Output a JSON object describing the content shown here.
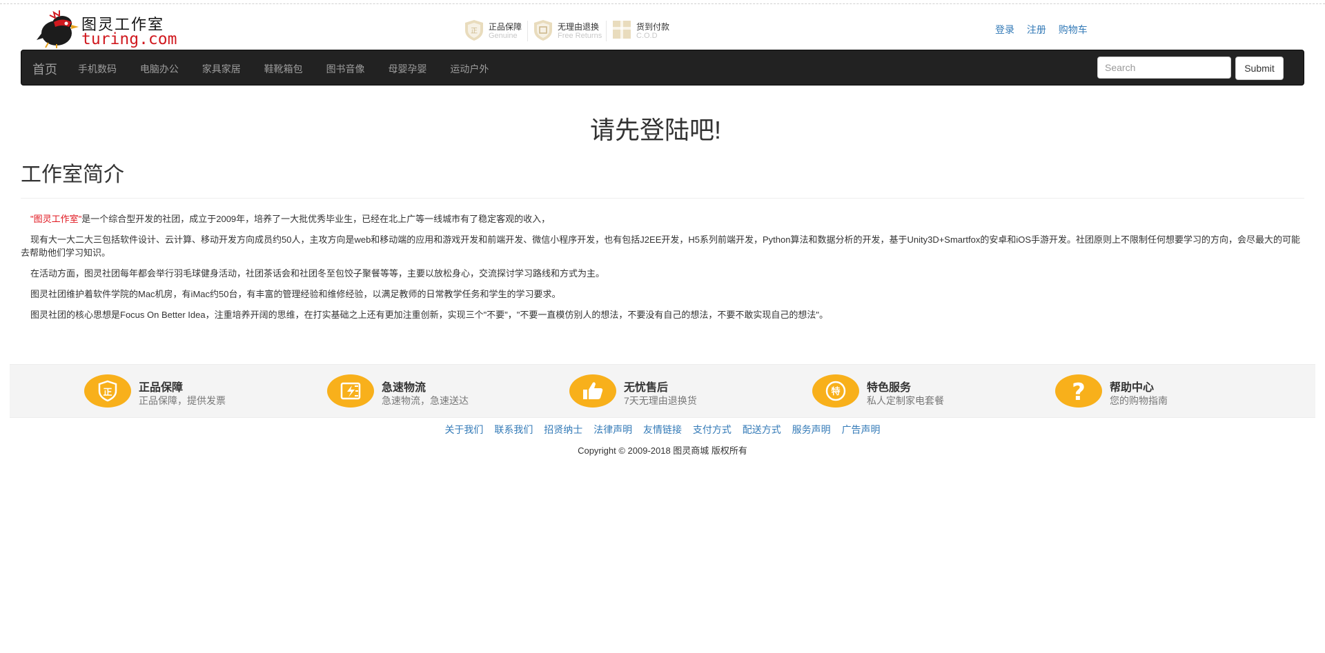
{
  "header": {
    "logo": {
      "cn": "图灵工作室",
      "en": "turing.com"
    },
    "guarantees": [
      {
        "title": "正品保障",
        "subtitle": "Genuine",
        "icon": "genuine-shield-icon"
      },
      {
        "title": "无理由退换",
        "subtitle": "Free Returns",
        "icon": "free-returns-shield-icon"
      },
      {
        "title": "货到付款",
        "subtitle": "C.O.D",
        "icon": "cod-gift-icon"
      }
    ],
    "links": {
      "login": "登录",
      "register": "注册",
      "cart": "购物车"
    }
  },
  "navbar": {
    "brand": "首页",
    "items": [
      "手机数码",
      "电脑办公",
      "家具家居",
      "鞋靴箱包",
      "图书音像",
      "母婴孕婴",
      "运动户外"
    ],
    "search_placeholder": "Search",
    "submit_label": "Submit"
  },
  "main": {
    "login_prompt": "请先登陆吧!",
    "section_title": "工作室简介",
    "paragraphs": {
      "p1_highlight": "\"图灵工作室\"",
      "p1_rest": "是一个综合型开发的社团，成立于2009年，培养了一大批优秀毕业生，已经在北上广等一线城市有了稳定客观的收入，",
      "p2": "现有大一大二大三包括软件设计、云计算、移动开发方向成员约50人，主攻方向是web和移动端的应用和游戏开发和前端开发、微信小程序开发，也有包括J2EE开发，H5系列前端开发，Python算法和数据分析的开发，基于Unity3D+Smartfox的安卓和iOS手游开发。社团原则上不限制任何想要学习的方向，会尽最大的可能去帮助他们学习知识。",
      "p3": "在活动方面，图灵社团每年都会举行羽毛球健身活动，社团茶话会和社团冬至包饺子聚餐等等，主要以放松身心，交流探讨学习路线和方式为主。",
      "p4": "图灵社团维护着软件学院的Mac机房，有iMac约50台，有丰富的管理经验和维修经验，以满足教师的日常教学任务和学生的学习要求。",
      "p5": "图灵社团的核心思想是Focus On Better Idea，注重培养开阔的思维，在打实基础之上还有更加注重创新，实现三个\"不要\"，\"不要一直模仿别人的想法，不要没有自己的想法，不要不敢实现自己的想法\"。"
    }
  },
  "features": [
    {
      "title": "正品保障",
      "desc": "正品保障，提供发票",
      "icon": "genuine-badge-icon"
    },
    {
      "title": "急速物流",
      "desc": "急速物流，急速送达",
      "icon": "fast-delivery-icon"
    },
    {
      "title": "无忧售后",
      "desc": "7天无理由退换货",
      "icon": "thumbs-up-icon"
    },
    {
      "title": "特色服务",
      "desc": "私人定制家电套餐",
      "icon": "special-service-icon"
    },
    {
      "title": "帮助中心",
      "desc": "您的购物指南",
      "icon": "help-question-icon"
    }
  ],
  "footer": {
    "links": [
      "关于我们",
      "联系我们",
      "招贤纳士",
      "法律声明",
      "友情链接",
      "支付方式",
      "配送方式",
      "服务声明",
      "广告声明"
    ],
    "copyright": "Copyright © 2009-2018 图灵商城 版权所有"
  },
  "colors": {
    "navbar_bg": "#222222",
    "link_blue": "#337ab7",
    "feature_orange": "#f8b01b",
    "highlight_red": "#e0141d",
    "logo_red": "#d0191f"
  }
}
